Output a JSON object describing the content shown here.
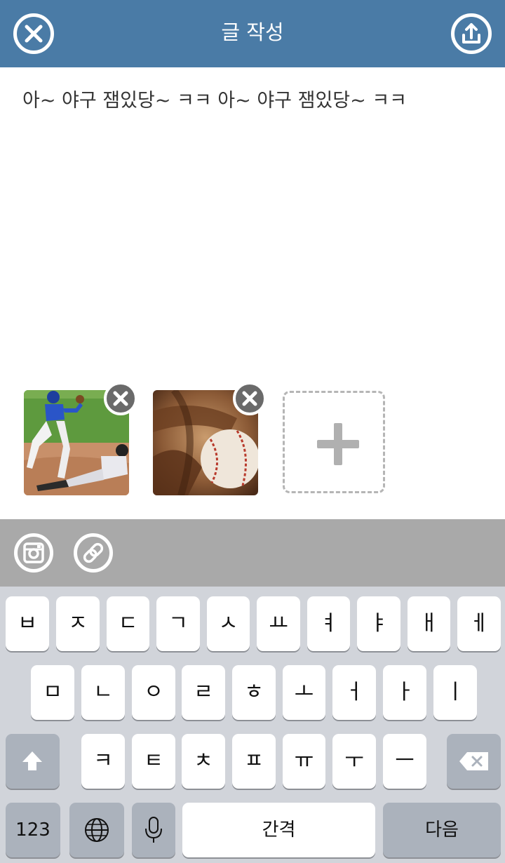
{
  "header": {
    "title": "글 작성",
    "close_icon": "close-circle-icon",
    "upload_icon": "upload-circle-icon",
    "background": "#4a7ba6"
  },
  "editor": {
    "text": "아~ 야구 잼있당~ ㅋㅋ 아~ 야구 잼있당~ ㅋㅋ"
  },
  "attachments": [
    {
      "name": "baseball-slide-photo",
      "remove_icon": "remove-circle-icon"
    },
    {
      "name": "baseball-glove-photo",
      "remove_icon": "remove-circle-icon"
    }
  ],
  "add_attachment_icon": "plus-icon",
  "toolbar": {
    "instagram_icon": "instagram-icon",
    "link_icon": "link-icon",
    "background": "#a9a9a9"
  },
  "keyboard": {
    "row1": [
      "ㅂ",
      "ㅈ",
      "ㄷ",
      "ㄱ",
      "ㅅ",
      "ㅛ",
      "ㅕ",
      "ㅑ",
      "ㅐ",
      "ㅔ"
    ],
    "row2": [
      "ㅁ",
      "ㄴ",
      "ㅇ",
      "ㄹ",
      "ㅎ",
      "ㅗ",
      "ㅓ",
      "ㅏ",
      "ㅣ"
    ],
    "row3": [
      "ㅋ",
      "ㅌ",
      "ㅊ",
      "ㅍ",
      "ㅠ",
      "ㅜ",
      "ㅡ"
    ],
    "shift_icon": "shift-arrow-icon",
    "backspace_icon": "backspace-icon",
    "numbers_label": "123",
    "globe_icon": "globe-icon",
    "mic_icon": "microphone-icon",
    "space_label": "간격",
    "return_label": "다음"
  }
}
